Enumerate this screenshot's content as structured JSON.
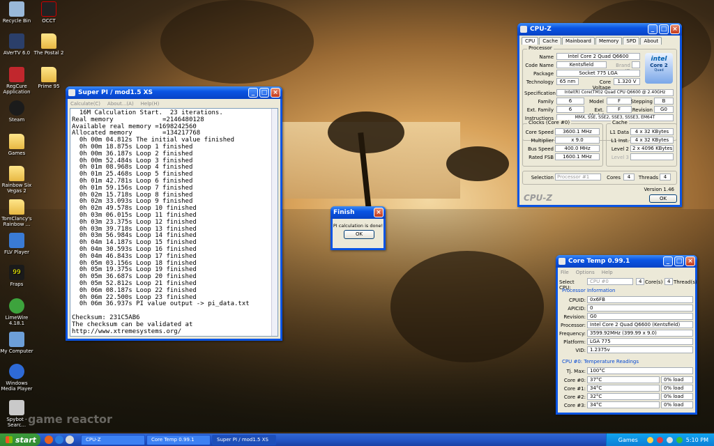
{
  "desktop_icons": [
    {
      "label": "Recycle Bin"
    },
    {
      "label": "OCCT"
    },
    {
      "label": "AVerTV 6.0"
    },
    {
      "label": "The Postal 2"
    },
    {
      "label": "RegCure Application"
    },
    {
      "label": "Prime 95"
    },
    {
      "label": "Steam"
    },
    {
      "label": "Games"
    },
    {
      "label": "Rainbow Six Vegas 2"
    },
    {
      "label": "TomClancy's Rainbow ..."
    },
    {
      "label": "FLV Player"
    },
    {
      "label": "Fraps"
    },
    {
      "label": "LimeWire 4.18.1"
    },
    {
      "label": "My Computer"
    },
    {
      "label": "Windows Media Player"
    },
    {
      "label": "Spybot - Searc..."
    }
  ],
  "superpi": {
    "title": "Super PI / mod1.5 XS",
    "menu": [
      "Calculate(C)",
      "About...(A)",
      "Help(H)"
    ],
    "lines": [
      "  16M Calculation Start.  23 iterations.",
      "Real memory             =2146480128",
      "Available real memory =1698242560",
      "Allocated memory        =134217768",
      "  0h 00m 04.812s The initial value finished",
      "  0h 00m 18.875s Loop 1 finished",
      "  0h 00m 36.187s Loop 2 finished",
      "  0h 00m 52.484s Loop 3 finished",
      "  0h 01m 08.968s Loop 4 finished",
      "  0h 01m 25.468s Loop 5 finished",
      "  0h 01m 42.781s Loop 6 finished",
      "  0h 01m 59.156s Loop 7 finished",
      "  0h 02m 15.718s Loop 8 finished",
      "  0h 02m 33.093s Loop 9 finished",
      "  0h 02m 49.578s Loop 10 finished",
      "  0h 03m 06.015s Loop 11 finished",
      "  0h 03m 23.375s Loop 12 finished",
      "  0h 03m 39.718s Loop 13 finished",
      "  0h 03m 56.984s Loop 14 finished",
      "  0h 04m 14.187s Loop 15 finished",
      "  0h 04m 30.593s Loop 16 finished",
      "  0h 04m 46.843s Loop 17 finished",
      "  0h 05m 03.156s Loop 18 finished",
      "  0h 05m 19.375s Loop 19 finished",
      "  0h 05m 36.687s Loop 20 finished",
      "  0h 05m 52.812s Loop 21 finished",
      "  0h 06m 08.187s Loop 22 finished",
      "  0h 06m 22.500s Loop 23 finished",
      "  0h 06m 36.937s PI value output -> pi_data.txt",
      "",
      "Checksum: 231C5AB6",
      "The checksum can be validated at",
      "http://www.xtremesystems.org/"
    ]
  },
  "finish_dialog": {
    "title": "Finish",
    "message": "PI calculation is done!",
    "ok": "OK"
  },
  "cpuz": {
    "title": "CPU-Z",
    "tabs": [
      "CPU",
      "Cache",
      "Mainboard",
      "Memory",
      "SPD",
      "About"
    ],
    "processor_title": "Processor",
    "name_label": "Name",
    "name": "Intel Core 2 Quad Q6600",
    "codename_label": "Code Name",
    "codename": "Kentsfield",
    "brandid_label": "Brand ID",
    "package_label": "Package",
    "package": "Socket 775 LGA",
    "technology_label": "Technology",
    "technology": "65 nm",
    "voltage_label": "Core Voltage",
    "voltage": "1.320 V",
    "spec_label": "Specification",
    "spec": "Intel(R) Core(TM)2 Quad CPU    Q6600  @ 2.40GHz",
    "family_label": "Family",
    "family": "6",
    "model_label": "Model",
    "model": "F",
    "stepping_label": "Stepping",
    "stepping": "B",
    "extfamily_label": "Ext. Family",
    "extfamily": "6",
    "extmodel_label": "Ext. Model",
    "extmodel": "F",
    "revision_label": "Revision",
    "revision": "G0",
    "instr_label": "Instructions",
    "instr": "MMX, SSE, SSE2, SSE3, SSSE3, EM64T",
    "clocks_title": "Clocks (Core #0)",
    "corespeed_label": "Core Speed",
    "corespeed": "3600.1 MHz",
    "mult_label": "Multiplier",
    "mult": "x 9.0",
    "bus_label": "Bus Speed",
    "bus": "400.0 MHz",
    "fsb_label": "Rated FSB",
    "fsb": "1600.1 MHz",
    "cache_title": "Cache",
    "l1d_label": "L1 Data",
    "l1d": "4 x 32 KBytes",
    "l1i_label": "L1 Inst.",
    "l1i": "4 x 32 KBytes",
    "l2_label": "Level 2",
    "l2": "2 x 4096 KBytes",
    "l3_label": "Level 3",
    "selection_label": "Selection",
    "selection": "Processor #1",
    "cores_label": "Cores",
    "cores": "4",
    "threads_label": "Threads",
    "threads": "4",
    "version": "Version 1.46",
    "brand": "CPU-Z",
    "ok": "OK",
    "intel_logo": "intel",
    "intel_sub": "Core 2",
    "intel_sub2": "Quad"
  },
  "coretemp": {
    "title": "Core Temp 0.99.1",
    "menu": [
      "File",
      "Options",
      "Help"
    ],
    "select_label": "Select CPU:",
    "select_value": "CPU #0",
    "cores_value": "4",
    "cores_label": "Core(s)",
    "threads_value": "4",
    "threads_label": "Thread(s)",
    "proc_info_title": "Processor Information",
    "cpuid_label": "CPUID:",
    "cpuid": "0x6FB",
    "apicid_label": "APICID:",
    "apicid": "0",
    "revision_label": "Revision:",
    "revision": "G0",
    "processor_label": "Processor:",
    "processor": "Intel Core 2 Quad Q6600 (Kentsfield)",
    "freq_label": "Frequency:",
    "freq": "3599.92MHz (399.99 x 9.0)",
    "platform_label": "Platform:",
    "platform": "LGA 775",
    "vid_label": "VID:",
    "vid": "1.2375v",
    "temps_title": "CPU #0: Temperature Readings",
    "tjmax_label": "Tj. Max:",
    "tjmax": "100°C",
    "cores": [
      {
        "label": "Core #0:",
        "temp": "37°C",
        "load": "0% load"
      },
      {
        "label": "Core #1:",
        "temp": "34°C",
        "load": "0% load"
      },
      {
        "label": "Core #2:",
        "temp": "32°C",
        "load": "0% load"
      },
      {
        "label": "Core #3:",
        "temp": "34°C",
        "load": "0% load"
      }
    ]
  },
  "taskbar": {
    "start": "start",
    "tasks": [
      "CPU-Z",
      "Core Temp 0.99.1",
      "Super PI / mod1.5 XS"
    ],
    "tray_text": "Games",
    "clock": "5:10 PM"
  },
  "watermark": "game reactor"
}
